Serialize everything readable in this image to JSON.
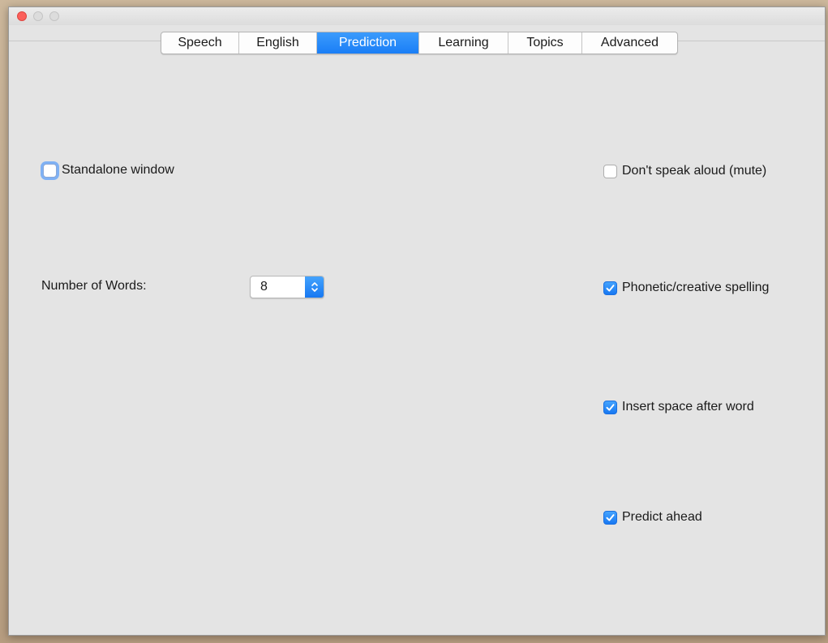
{
  "tabs": [
    {
      "label": "Speech",
      "active": false
    },
    {
      "label": "English",
      "active": false
    },
    {
      "label": "Prediction",
      "active": true
    },
    {
      "label": "Learning",
      "active": false
    },
    {
      "label": "Topics",
      "active": false
    },
    {
      "label": "Advanced",
      "active": false
    }
  ],
  "options": {
    "standalone": {
      "label": "Standalone window",
      "checked": false
    },
    "mute": {
      "label": "Don't speak aloud (mute)",
      "checked": false
    },
    "phonetic": {
      "label": "Phonetic/creative spelling",
      "checked": true
    },
    "insert_space": {
      "label": "Insert space after word",
      "checked": true
    },
    "predict_ahead": {
      "label": "Predict ahead",
      "checked": true
    }
  },
  "number_of_words": {
    "label": "Number of Words:",
    "value": "8"
  },
  "colors": {
    "accent": "#1a7ef6",
    "close_button": "#fc605b",
    "window_bg": "#e4e4e4"
  },
  "icons": {
    "checkmark": "checkmark-icon",
    "stepper": "chevron-up-down-icon"
  }
}
